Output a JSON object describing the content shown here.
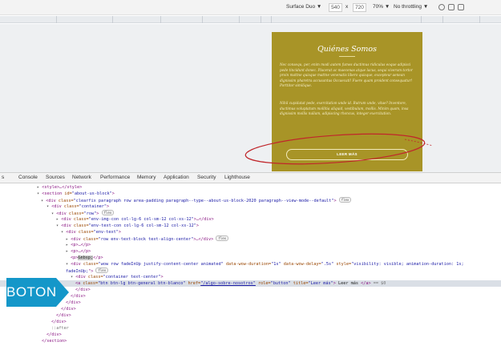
{
  "device_toolbar": {
    "device": "Surface Duo ▼",
    "width": "540",
    "times": "x",
    "height": "720",
    "zoom": "70% ▼",
    "throttle": "No throttling ▼"
  },
  "page": {
    "title": "Quiénes Somos",
    "paragraph_1": "Nec consequ, per, enim modi autem fumes ductimus ridiculus eoque adipisci pede tincidunt donec. Placerat ac maecenas atque lacus, sequi viverum tortor proin mattne quisque mattne venenatis libero quisque, excepteur aenean dignissim pharetra accusantus Occaecati! Fuere quam proident consequatur! Porttitor similique.",
    "paragraph_2": "Nihil cupidatat pede, exercitation unde id. Rutrum unde, vitae? Inventore, ductimus voluptatum mollitia aliquid, vestibulum, mollis. Minim quam, insa dignissim mollis nullam, adipiscing rhoncus, integer exercitation.",
    "button_label": "LEER MÁS"
  },
  "tabs": [
    "s",
    "Console",
    "Sources",
    "Network",
    "Performance",
    "Memory",
    "Application",
    "Security",
    "Lighthouse"
  ],
  "code": {
    "l1_tag": "<style>",
    "l1_rest": "…</style>",
    "l2_a": "<section",
    "l2_b": " id=",
    "l2_c": "\"about-us-block\"",
    "l2_d": ">",
    "l3_a": "<div",
    "l3_b": " class=",
    "l3_c": "\"clearfix paragraph row area-padding paragraph--type--about-us-block-2020 paragraph--view-mode--default\"",
    "l3_d": ">",
    "l3_badge": "flex",
    "l4_a": "<div",
    "l4_b": " class=",
    "l4_c": "\"container\"",
    "l4_d": ">",
    "l5_a": "<div",
    "l5_b": " class=",
    "l5_c": "\"row\"",
    "l5_d": ">",
    "l5_badge": "flex",
    "l6_a": "<div",
    "l6_b": " class=",
    "l6_c": "\"env-img-con col-lg-6 col-sm-12 col-xs-12\"",
    "l6_d": ">…</div>",
    "l7_a": "<div",
    "l7_b": " class=",
    "l7_c": "\"env-text-con col-lg-6 col-sm-12 col-xs-12\"",
    "l7_d": ">",
    "l8_a": "<div",
    "l8_b": " class=",
    "l8_c": "\"env-text\"",
    "l8_d": ">",
    "l9_a": "<div",
    "l9_b": " class=",
    "l9_c": "\"row env-text-block text-align-center\"",
    "l9_d": ">…</div>",
    "l9_badge": "flex",
    "l10": "<p>…</p>",
    "l11": "<p>…</p>",
    "l12_a": "<p>",
    "l12_b": "&nbsp;",
    "l12_c": "</p>",
    "l13_a": "<div",
    "l13_b": " class=",
    "l13_c": "\"wow row  fadeInUp justify-content-center animated\"",
    "l13_d": " data-wow-duration=",
    "l13_e": "\"1s\"",
    "l13_f": " data-wow-delay=",
    "l13_g": "\".5s\"",
    "l13_h": " style=",
    "l13_i": "\"visibility: visible; animation-duration: 1s;",
    "l14_a": "fadeInUp;",
    "l14_b": "\">",
    "l14_badge": "flex",
    "l15_a": "<div",
    "l15_b": " class=",
    "l15_c": "\"container text-center\"",
    "l15_d": ">",
    "l16_a": "<a",
    "l16_b": " class=",
    "l16_c": "\"btn btn-lg btn-general btn-blanco\"",
    "l16_d": " href=",
    "l16_e": "\"/algo-sobre-nosotros\"",
    "l16_f": " role=",
    "l16_g": "\"button\"",
    "l16_h": " title=",
    "l16_i": "\"Leer más\"",
    "l16_j": ">",
    "l16_k": " Leer más ",
    "l16_l": "</a>",
    "l16_m": " == $0",
    "l17": "</div>",
    "l18": "</div>",
    "l19": "</div>",
    "l20": "</div>",
    "l21": "</div>",
    "l22": "</div>",
    "l23": "::after",
    "l24": "</div>",
    "l25": "</section>"
  },
  "annotation": {
    "label": "BOTON",
    "color": "#1497c9"
  },
  "colors": {
    "card_bg": "#a89427",
    "ellipse": "#c0262b"
  }
}
